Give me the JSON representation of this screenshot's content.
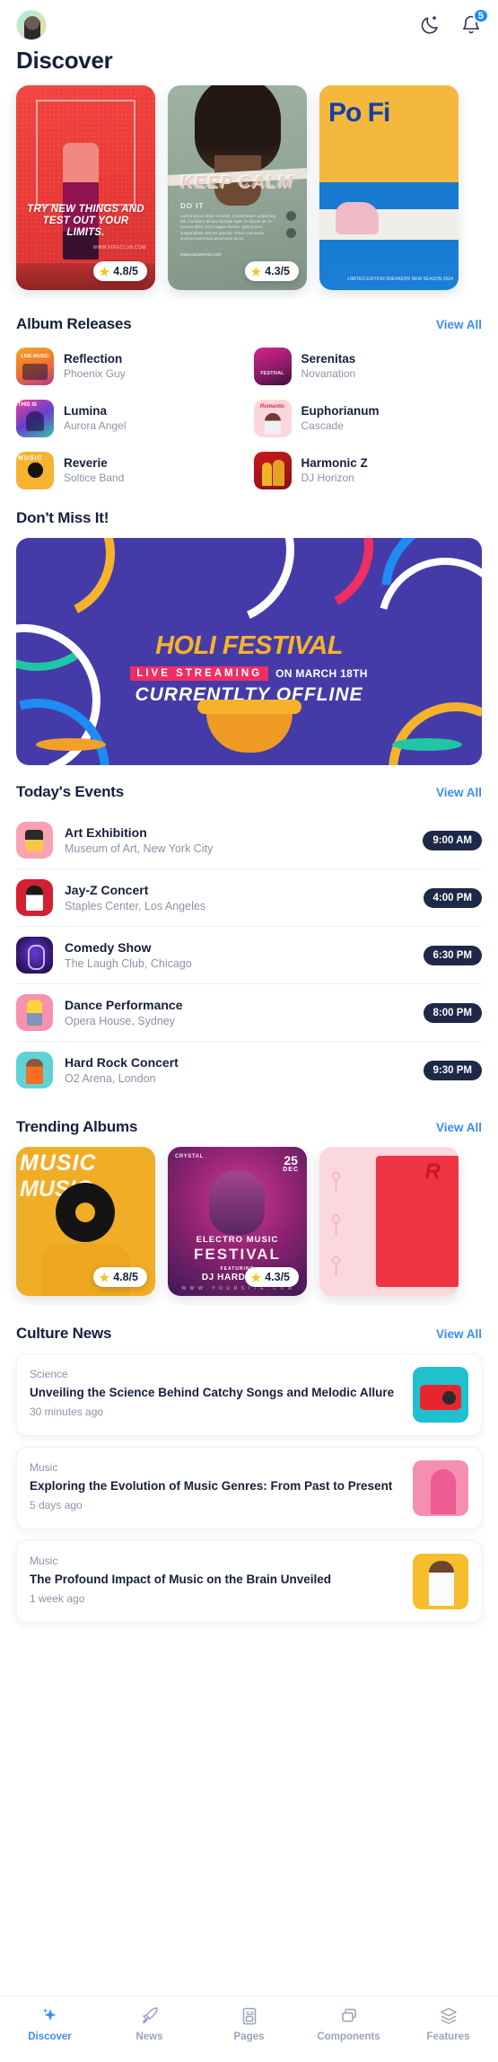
{
  "header": {
    "avatar_name": "user-avatar",
    "dark_mode_icon": "moon-icon",
    "notifications_icon": "bell-icon",
    "notification_count": "5",
    "page_title": "Discover"
  },
  "hero": {
    "cards": [
      {
        "id": "try-new-things",
        "headline": "TRY NEW THINGS AND TEST OUT YOUR LIMITS.",
        "url": "WWW.FIRECLUB.COM",
        "rating": "4.8/5"
      },
      {
        "id": "keep-calm",
        "headline": "KEEP CALM",
        "sub": "DO IT",
        "body": "Lorem ipsum dolor sit amet, consectetuer adipiscing elit. Curabitur dictum facilisis eget. In dictum sit. In laoreet dolor eros magna dictum. Quis ipsum suspendisse ultrices gravida. Risus commodo viverra maecenas accumsan lacus.",
        "url": "www.cusummer.com",
        "rating": "4.3/5"
      },
      {
        "id": "pop-fest",
        "headline": "Po Fi",
        "caption": "LIMITED EDITION SNEAKERS NEW SEASON 2024"
      }
    ]
  },
  "album_releases": {
    "title": "Album Releases",
    "view_all": "View All",
    "items": [
      {
        "name": "Reflection",
        "artist": "Phoenix Guy",
        "art": "art-a"
      },
      {
        "name": "Serenitas",
        "artist": "Novanation",
        "art": "art-b"
      },
      {
        "name": "Lumina",
        "artist": "Aurora Angel",
        "art": "art-c"
      },
      {
        "name": "Euphorianum",
        "artist": "Cascade",
        "art": "art-d"
      },
      {
        "name": "Reverie",
        "artist": "Soltice Band",
        "art": "art-e"
      },
      {
        "name": "Harmonic Z",
        "artist": "DJ Horizon",
        "art": "art-f"
      }
    ]
  },
  "dont_miss": {
    "title": "Don't Miss It!",
    "banner": {
      "title": "HOLI FESTIVAL",
      "live_label": "LIVE STREAMING",
      "date_label": "ON MARCH 18TH",
      "status": "CURRENTLTY OFFLINE",
      "bg_color": "#453ba8",
      "title_color": "#f5b32b",
      "live_color": "#ef2e63"
    }
  },
  "todays_events": {
    "title": "Today's Events",
    "view_all": "View All",
    "items": [
      {
        "title": "Art Exhibition",
        "place": "Museum of Art, New York City",
        "time": "9:00 AM",
        "art": "ev-a"
      },
      {
        "title": "Jay-Z Concert",
        "place": "Staples Center, Los Angeles",
        "time": "4:00 PM",
        "art": "ev-b"
      },
      {
        "title": "Comedy Show",
        "place": "The Laugh Club, Chicago",
        "time": "6:30 PM",
        "art": "ev-c"
      },
      {
        "title": "Dance Performance",
        "place": "Opera House, Sydney",
        "time": "8:00 PM",
        "art": "ev-d"
      },
      {
        "title": "Hard Rock Concert",
        "place": "O2 Arena, London",
        "time": "9:30 PM",
        "art": "ev-e"
      }
    ]
  },
  "trending_albums": {
    "title": "Trending Albums",
    "view_all": "View All",
    "items": [
      {
        "id": "music-vinyl",
        "word1": "MUSIC",
        "word2": "MUSIC",
        "rating": "4.8/5"
      },
      {
        "id": "electro-music-festival",
        "brand": "CRYSTAL",
        "day": "25",
        "month": "DEC",
        "line1": "ELECTRO MUSIC",
        "line2": "FESTIVAL",
        "line3": "FEATURING",
        "line4": "DJ HARDWALL",
        "url": "W W W . Y O U R S I T E . C O M",
        "rating": "4.3/5"
      },
      {
        "id": "rose-red",
        "letter": "R"
      }
    ]
  },
  "culture_news": {
    "title": "Culture News",
    "view_all": "View All",
    "items": [
      {
        "category": "Science",
        "title": "Unveiling the Science Behind Catchy Songs and Melodic Allure",
        "time": "30 minutes ago",
        "thumb": "nt-a"
      },
      {
        "category": "Music",
        "title": "Exploring the Evolution of Music Genres: From Past to Present",
        "time": "5 days ago",
        "thumb": "nt-b"
      },
      {
        "category": "Music",
        "title": "The Profound Impact of Music on the Brain Unveiled",
        "time": "1 week ago",
        "thumb": "nt-c"
      }
    ]
  },
  "bottom_nav": {
    "active": "Discover",
    "items": [
      {
        "label": "Discover",
        "icon": "sparkle-icon"
      },
      {
        "label": "News",
        "icon": "rocket-icon"
      },
      {
        "label": "Pages",
        "icon": "document-icon"
      },
      {
        "label": "Components",
        "icon": "folders-icon"
      },
      {
        "label": "Features",
        "icon": "layers-icon"
      }
    ]
  },
  "theme": {
    "accent": "#3d8bf8",
    "text_dark": "#16203c",
    "text_muted": "#8b93a7",
    "badge_bg": "#1e2949"
  }
}
